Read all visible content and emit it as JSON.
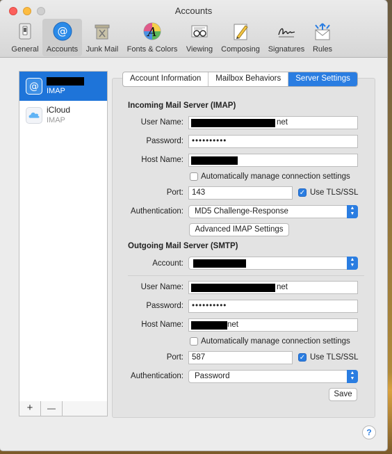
{
  "window": {
    "title": "Accounts"
  },
  "toolbar": {
    "items": [
      {
        "label": "General",
        "icon": "general-icon"
      },
      {
        "label": "Accounts",
        "icon": "accounts-at-icon"
      },
      {
        "label": "Junk Mail",
        "icon": "junk-mail-icon"
      },
      {
        "label": "Fonts & Colors",
        "icon": "fonts-colors-icon"
      },
      {
        "label": "Viewing",
        "icon": "viewing-icon"
      },
      {
        "label": "Composing",
        "icon": "composing-icon"
      },
      {
        "label": "Signatures",
        "icon": "signatures-icon"
      },
      {
        "label": "Rules",
        "icon": "rules-icon"
      }
    ],
    "selected": "Accounts"
  },
  "sidebar": {
    "accounts": [
      {
        "name": "",
        "type": "IMAP",
        "selected": true,
        "icon": "at-mail-icon"
      },
      {
        "name": "iCloud",
        "type": "IMAP",
        "selected": false,
        "icon": "icloud-icon"
      }
    ],
    "add_label": "+",
    "remove_label": "—"
  },
  "tabs": [
    {
      "label": "Account Information",
      "selected": false
    },
    {
      "label": "Mailbox Behaviors",
      "selected": false
    },
    {
      "label": "Server Settings",
      "selected": true
    }
  ],
  "incoming": {
    "heading": "Incoming Mail Server (IMAP)",
    "user_name_label": "User Name:",
    "user_name_suffix": "net",
    "password_label": "Password:",
    "password_value": "••••••••••",
    "host_name_label": "Host Name:",
    "auto_manage_label": "Automatically manage connection settings",
    "auto_manage_checked": false,
    "port_label": "Port:",
    "port_value": "143",
    "tls_label": "Use TLS/SSL",
    "tls_checked": true,
    "auth_label": "Authentication:",
    "auth_value": "MD5 Challenge-Response",
    "advanced_button": "Advanced IMAP Settings"
  },
  "outgoing": {
    "heading": "Outgoing Mail Server (SMTP)",
    "account_label": "Account:",
    "user_name_label": "User Name:",
    "user_name_suffix": "net",
    "password_label": "Password:",
    "password_value": "••••••••••",
    "host_name_label": "Host Name:",
    "host_name_suffix": "net",
    "auto_manage_label": "Automatically manage connection settings",
    "auto_manage_checked": false,
    "port_label": "Port:",
    "port_value": "587",
    "tls_label": "Use TLS/SSL",
    "tls_checked": true,
    "auth_label": "Authentication:",
    "auth_value": "Password"
  },
  "save_button": "Save",
  "help_label": "?",
  "colors": {
    "accent": "#2a7de1",
    "selection": "#1e74d9"
  }
}
